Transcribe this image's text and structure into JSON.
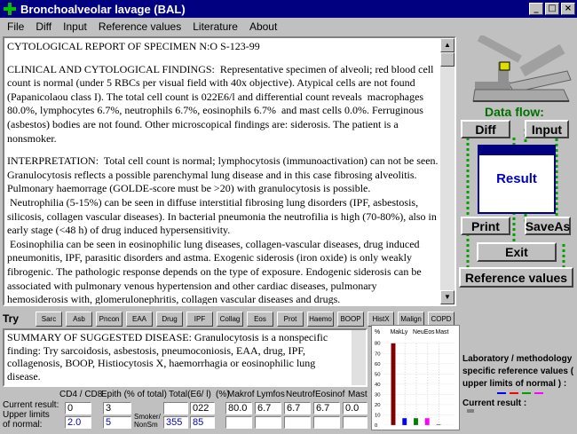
{
  "window": {
    "title": "Bronchoalveolar lavage (BAL)",
    "min": "_",
    "max": "□",
    "close": "×"
  },
  "menu": [
    "File",
    "Diff",
    "Input",
    "Reference values",
    "Literature",
    "About"
  ],
  "report": {
    "paragraphs": [
      "CYTOLOGICAL REPORT OF SPECIMEN N:O S-123-99",
      "CLINICAL AND CYTOLOGICAL FINDINGS:  Representative specimen of alveoli; red blood cell count is normal (under 5 RBCs per visual field with 40x objective). Atypical cells are not found (Papanicolaou class I). The total cell count is 022E6/l and differential count reveals  macrophages 80.0%, lymphocytes 6.7%, neutrophils 6.7%, eosinophils 6.7%  and mast cells 0.0%. Ferruginous (asbestos) bodies are not found. Other microscopical findings are: siderosis. The patient is a nonsmoker.",
      "INTERPRETATION:  Total cell count is normal; lymphocytosis (immunoactivation) can not be seen. Granulocytosis reflects a possible parenchymal lung disease and in this case fibrosing alveolitis. Pulmonary haemorrage (GOLDE-score must be >20) with granulocytosis is possible.\n Neutrophilia (5-15%) can be seen in diffuse interstitial fibrosing lung disorders (IPF, asbestosis, silicosis, collagen vascular diseases). In bacterial pneumonia the neutrofilia is high (70-80%), also in early stage (<48 h) of drug induced hypersensitivity.\n Eosinophilia can be seen in eosinophilic lung diseases, collagen-vascular diseases, drug induced pneumonitis, IPF, parasitic disorders and astma. Exogenic siderosis (iron oxide) is only weakly fibrogenic. The pathologic response depends on the type of exposure. Endogenic siderosis can be associated with pulmonary venous hypertension and other cardiac diseases, pulmonary hemosiderosis with, glomerulonephritis, collagen vascular diseases and drugs."
    ]
  },
  "flow": {
    "label": "Data flow:",
    "diff": "Diff",
    "input": "Input",
    "result": "Result",
    "print": "Print",
    "saveas": "SaveAs",
    "exit": "Exit",
    "reference": "Reference values"
  },
  "try": {
    "label": "Try",
    "buttons": [
      "Sarc",
      "Asb",
      "Pncon",
      "EAA",
      "Drug",
      "IPF",
      "Collag",
      "Eos",
      "Prot",
      "Haemo",
      "BOOP",
      "HistX",
      "Malign",
      "COPD"
    ]
  },
  "summary": "SUMMARY OF SUGGESTED DISEASE:  Granulocytosis is a nonspecific finding: Try sarcoidosis, asbestosis, pneumoconiosis, EAA, drug, IPF, collagenosis, BOOP, Histiocytosis X, haemorrhagia or eosinophilic lung disease.",
  "table": {
    "headers": {
      "cd4cd8": "CD4 / CD8",
      "epith": "Epith (% of total)",
      "total": "Total(E6/ l)",
      "pct": "(%)",
      "makrof": "Makrof",
      "lymfos": "Lymfos",
      "neutrof": "Neutrof",
      "eosinof": "Eosinof",
      "mast": "Mast"
    },
    "row_labels": {
      "current": "Current result:",
      "upper": "Upper limits",
      "normal": "of normal:",
      "smoker": "Smoker/",
      "nonsm": "NonSm"
    },
    "current": {
      "cd4cd8": "0",
      "epith": "3",
      "smoker": "",
      "total": "022",
      "makrof": "80.0",
      "lymfos": "6.7",
      "neutrof": "6.7",
      "eosinof": "6.7",
      "mast": "0.0"
    },
    "upper": {
      "cd4cd8": "2.0",
      "epith": "5",
      "smoker": "355",
      "total": "85",
      "makrof": "",
      "lymfos": "",
      "neutrof": "",
      "eosinof": "",
      "mast": ""
    }
  },
  "chart_data": {
    "type": "bar",
    "ylabel": "%",
    "categories": [
      "Mak",
      "Ly",
      "Neu",
      "Eos",
      "Mast"
    ],
    "y_ticks": [
      "80",
      "70",
      "60",
      "50",
      "40",
      "30",
      "20",
      "10",
      "0"
    ],
    "ylim": [
      0,
      80
    ],
    "series": [
      {
        "values": [
          80.0,
          6.7,
          6.7,
          6.7,
          0.0
        ]
      }
    ],
    "colors": {
      "mak": "#800000",
      "ly": "#0000ff",
      "neu": "#008000",
      "eos": "#ff00ff",
      "mast": "#808080"
    }
  },
  "legend": {
    "text": "Laboratory / methodology specific reference values ( upper limits of normal ) :",
    "current_result": "Current result :"
  }
}
